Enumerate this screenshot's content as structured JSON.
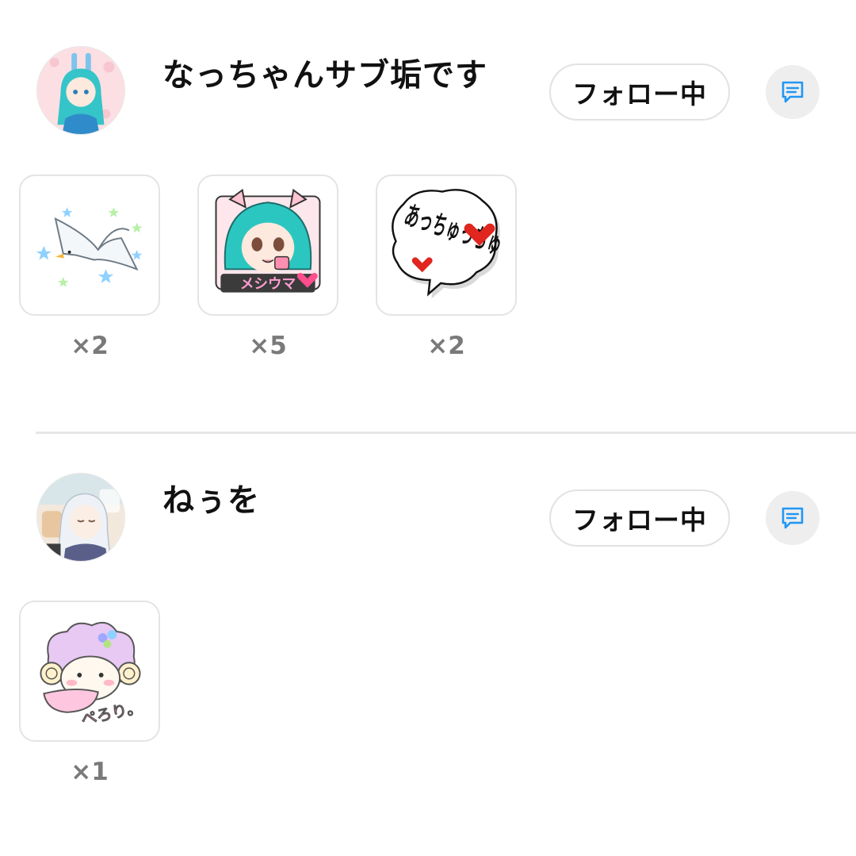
{
  "colors": {
    "accent": "#2196f3",
    "divider": "#e6e6e6",
    "count_text": "#7a7a7a",
    "msg_button_bg": "#eeeeee"
  },
  "entries": [
    {
      "username": "なっちゃんサブ垢です",
      "follow_label": "フォロー中",
      "message_icon": "chat-bubble-icon",
      "stickers": [
        {
          "name": "seagull-stars",
          "count": "×2"
        },
        {
          "name": "teal-hair-girl-meshiuma",
          "count": "×5",
          "caption": "メシウマ"
        },
        {
          "name": "acchuchu-hearts",
          "count": "×2",
          "caption": "あっちゅっちゅ"
        }
      ]
    },
    {
      "username": "ねぅを",
      "follow_label": "フォロー中",
      "message_icon": "chat-bubble-icon",
      "stickers": [
        {
          "name": "sheep-perori",
          "count": "×1",
          "caption": "ぺろり。"
        }
      ]
    }
  ]
}
